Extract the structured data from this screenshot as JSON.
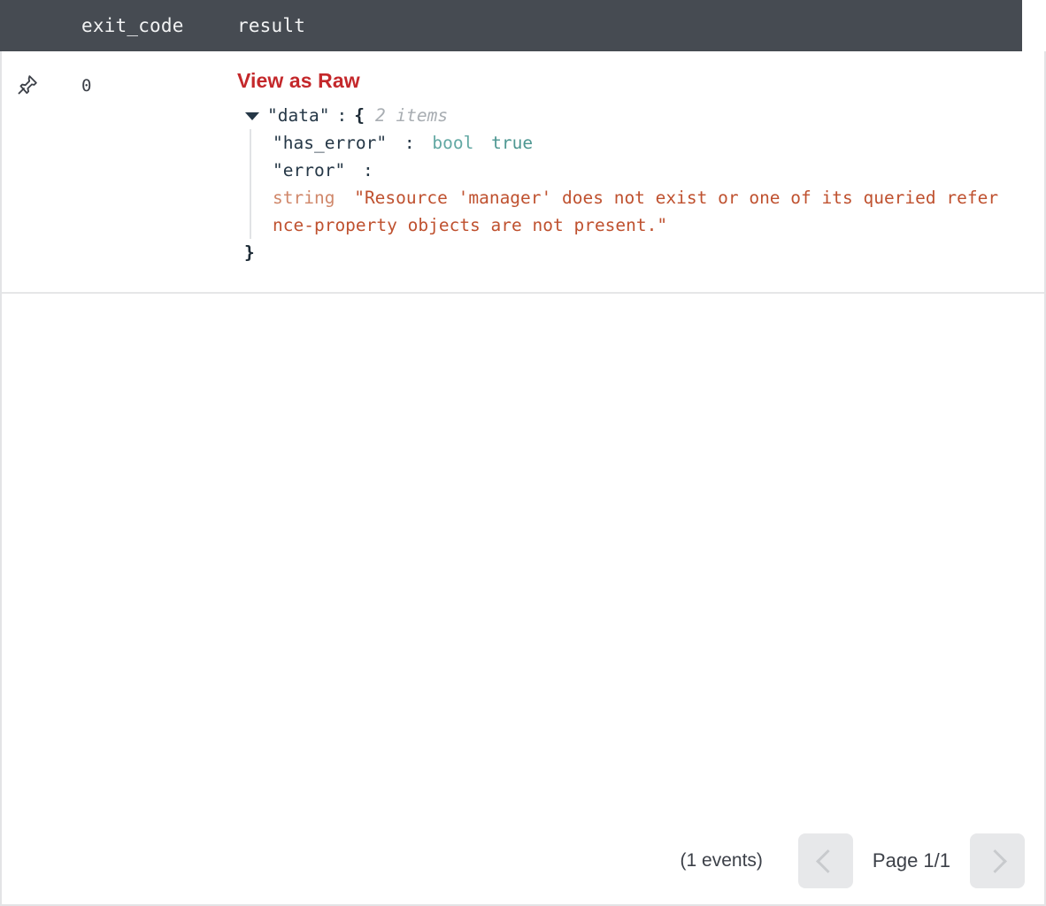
{
  "table": {
    "columns": [
      {
        "key": "pin",
        "label": ""
      },
      {
        "key": "exit_code",
        "label": "exit_code"
      },
      {
        "key": "result",
        "label": "result"
      }
    ],
    "header": {
      "exit_code_label": "exit_code",
      "result_label": "result"
    },
    "rows": [
      {
        "pin_icon": "pin-icon",
        "exit_code": "0",
        "result": {
          "view_raw_label": "View as Raw",
          "json": {
            "root_key": "\"data\"",
            "root_colon": ":",
            "root_brace_open": "{",
            "root_item_count": "2 items",
            "close_brace": "}",
            "entries": [
              {
                "key": "\"has_error\"",
                "colon": ":",
                "type": "bool",
                "value": "true"
              },
              {
                "key": "\"error\"",
                "colon": ":",
                "type": "string",
                "value_line_1": "\"Resource 'manager' does not exist or one of its queried refer",
                "value_line_2": "nce-property objects are not present.\""
              }
            ]
          }
        }
      }
    ]
  },
  "footer": {
    "events_count": "(1 events)",
    "prev_label": "chevron-left",
    "page_label": "Page 1/1",
    "next_label": "chevron-right"
  },
  "colors": {
    "header_bg": "#464b52",
    "header_text": "#f2f3f4",
    "accent_link": "#c4282b",
    "json_key": "#253746",
    "json_bool": "#4e9792",
    "json_string": "#bf512f",
    "json_type_muted": "#d0876a",
    "count_muted": "#a8adb2",
    "border": "#e3e4e6",
    "pager_bg": "#e7e8ea",
    "pager_chevron": "#c8cacd"
  }
}
